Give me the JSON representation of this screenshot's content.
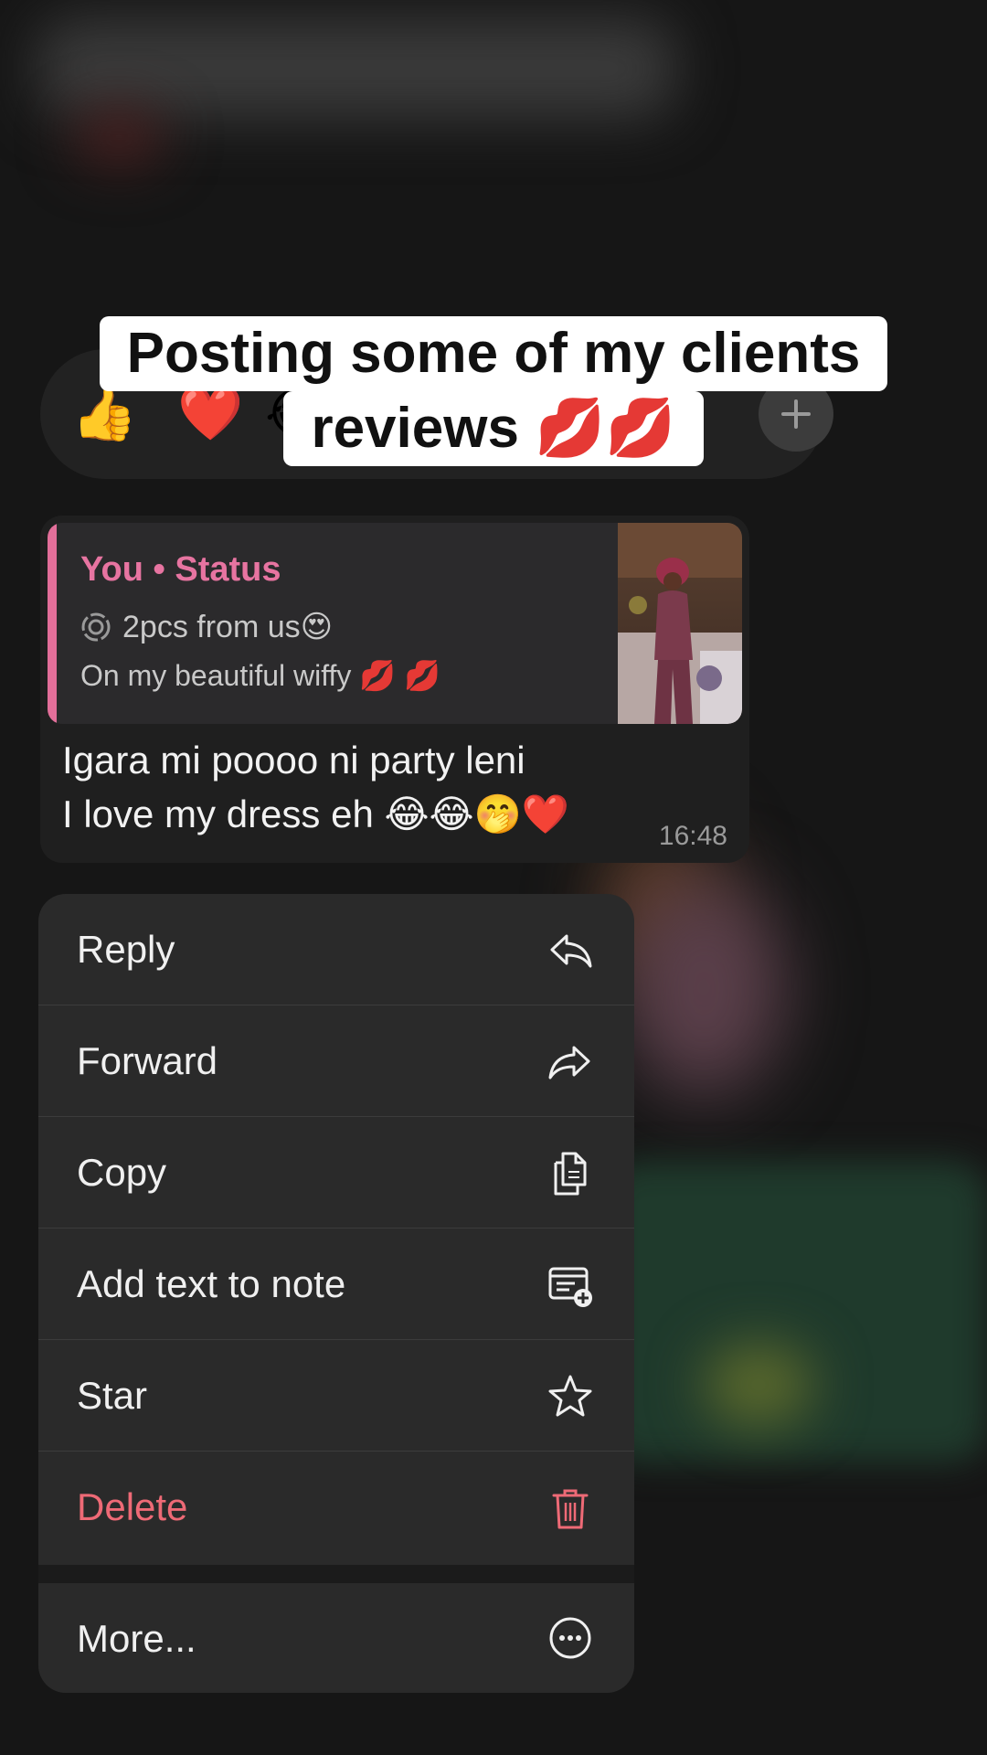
{
  "caption": {
    "line1": "Posting some of my clients",
    "line2": "reviews 💋💋"
  },
  "reactions": [
    "👍",
    "❤️",
    "😂"
  ],
  "message": {
    "quote_author": "You • Status",
    "quote_line1": "2pcs from us😍",
    "quote_line2": "On my beautiful wiffy 💋 💋",
    "text_line1": "Igara mi poooo ni party leni",
    "text_line2": "I love my dress eh 😂😂🤭❤️",
    "time": "16:48"
  },
  "menu": {
    "items": [
      {
        "label": "Reply",
        "icon": "reply-icon"
      },
      {
        "label": "Forward",
        "icon": "forward-icon"
      },
      {
        "label": "Copy",
        "icon": "copy-icon"
      },
      {
        "label": "Add text to note",
        "icon": "add-note-icon"
      },
      {
        "label": "Star",
        "icon": "star-icon"
      },
      {
        "label": "Delete",
        "icon": "trash-icon"
      }
    ],
    "more": {
      "label": "More...",
      "icon": "more-icon"
    }
  },
  "colors": {
    "accent_pink": "#e774a1",
    "danger": "#ee6a76"
  }
}
